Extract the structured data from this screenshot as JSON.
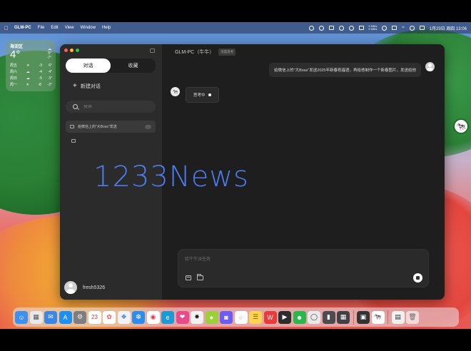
{
  "menubar": {
    "app_name": "GLM-PC",
    "menus": [
      "File",
      "Edit",
      "View",
      "Window",
      "Help"
    ],
    "network_up": "0 KB/s",
    "network_down": "0 KB/s",
    "datetime": "1月23日 周四  13:06"
  },
  "weather": {
    "city": "海淀区",
    "temp": "4°",
    "high": "5°",
    "low": "-7°",
    "forecast": [
      {
        "day": "周五",
        "icon": "sun",
        "low": "-3",
        "high": "6°"
      },
      {
        "day": "周六",
        "icon": "cloud",
        "low": "-4",
        "high": "4°"
      },
      {
        "day": "周日",
        "icon": "cloud",
        "low": "-5",
        "high": "3°"
      },
      {
        "day": "周一",
        "icon": "sun",
        "low": "-8",
        "high": "-2°"
      }
    ]
  },
  "sidebar": {
    "tabs": [
      {
        "label": "对话",
        "active": true
      },
      {
        "label": "收藏",
        "active": false
      }
    ],
    "new_chat_label": "新建对话",
    "search_placeholder": "搜索",
    "conversations": [
      {
        "title": "给微信上的\"大Boss\"发送"
      }
    ],
    "user_name": "fresh5326"
  },
  "chat": {
    "header_title": "GLM-PC（牛牛）",
    "header_badge": "深度思考",
    "user_message": "给微信上的\"大Boss\"发送2025年新春祝福语，再给他制作一个新春图片，发送给他",
    "bot_status": "思考中"
  },
  "watermark": "1233News",
  "composer": {
    "placeholder": "给牛牛派任务"
  },
  "dock": {
    "icons": [
      "finder-icon",
      "launchpad-icon",
      "mail-icon",
      "app-store-icon",
      "settings-icon",
      "calendar-icon",
      "photos-icon",
      "app-icon",
      "safari-icon",
      "chrome-icon",
      "edge-icon",
      "app-icon-2",
      "chatgpt-icon",
      "app-icon-3",
      "app-icon-4",
      "app-icon-5",
      "notes-icon",
      "wps-icon",
      "final-cut-icon",
      "wechat-icon",
      "app-icon-6",
      "app-icon-7",
      "calculator-icon",
      "screen-icon",
      "glm-icon",
      "finder-window-icon",
      "trash-icon"
    ],
    "calendar_day": "23"
  }
}
